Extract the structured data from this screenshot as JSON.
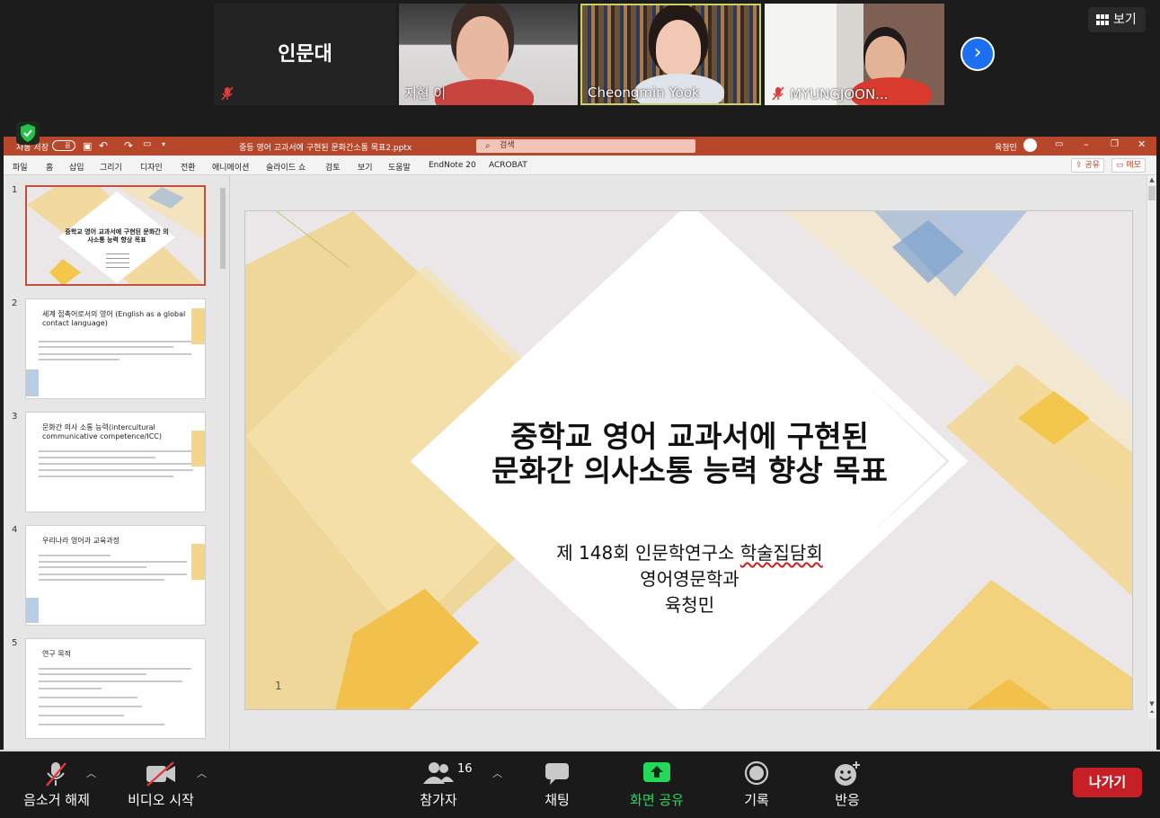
{
  "gallery": {
    "tiles": [
      {
        "name": "인문대",
        "muted": true
      },
      {
        "name": "지현 이",
        "muted": false
      },
      {
        "name": "Cheongmin Yook",
        "muted": false,
        "active_speaker": true
      },
      {
        "name": "MYUNGJOON...",
        "muted": true
      }
    ],
    "view_label": "보기"
  },
  "ppt": {
    "autosave_label": "자동 저장",
    "toggle_label": "끔",
    "file_title": "중등 영어 교과서에 구현된 문화간소통 목표2.pptx",
    "search_placeholder": "검색",
    "user_name": "육청민",
    "menu": [
      "파일",
      "홈",
      "삽입",
      "그리기",
      "디자인",
      "전환",
      "애니메이션",
      "슬라이드 쇼",
      "검토",
      "보기",
      "도움말",
      "EndNote 20",
      "ACROBAT"
    ],
    "share_label": "공유",
    "memo_label": "메모",
    "thumbnails": [
      {
        "num": "1",
        "title": "중학교 영어 교과서에 구현된 문화간 의사소통 능력 향상 목표"
      },
      {
        "num": "2",
        "title": "세계 접촉어로서의 영어 (English as a global contact language)"
      },
      {
        "num": "3",
        "title": "문화간 의사 소통 능력(intercultural communicative competence/ICC)"
      },
      {
        "num": "4",
        "title": "우리나라 영어과 교육과정"
      },
      {
        "num": "5",
        "title": "연구 목적"
      }
    ],
    "slide": {
      "title_line1": "중학교 영어 교과서에 구현된",
      "title_line2": "문화간 의사소통 능력 향상 목표",
      "sub_prefix": "제 148회 인문학연구소 ",
      "sub_underlined": "학술집담회",
      "sub_line2": "영어영문학과",
      "sub_line3": "육청민",
      "number": "1"
    }
  },
  "toolbar": {
    "unmute": "음소거 해제",
    "start_video": "비디오 시작",
    "participants": "참가자",
    "participant_count": "16",
    "chat": "채팅",
    "share_screen": "화면 공유",
    "record": "기록",
    "reactions": "반응",
    "leave": "나가기"
  },
  "colors": {
    "ppt_accent": "#b7472a",
    "share_green": "#23d959",
    "leave_red": "#c61f25",
    "next_blue": "#1b6ff0"
  }
}
